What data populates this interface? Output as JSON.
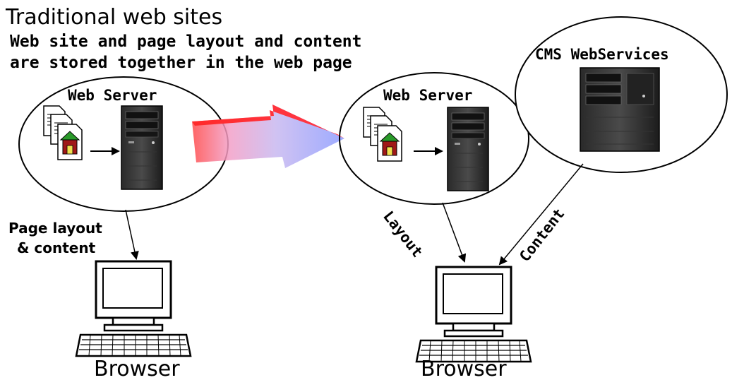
{
  "title": "Traditional web sites",
  "subtitle_line1": "Web site and page layout and content",
  "subtitle_line2": "are stored together in the web page",
  "left": {
    "server_label": "Web Server",
    "arrow_label_line1": "Page layout",
    "arrow_label_line2": "& content",
    "browser_label": "Browser"
  },
  "right": {
    "server_label": "Web Server",
    "cms_label": "CMS WebServices",
    "layout_label": "Layout",
    "content_label": "Content",
    "browser_label": "Browser"
  }
}
